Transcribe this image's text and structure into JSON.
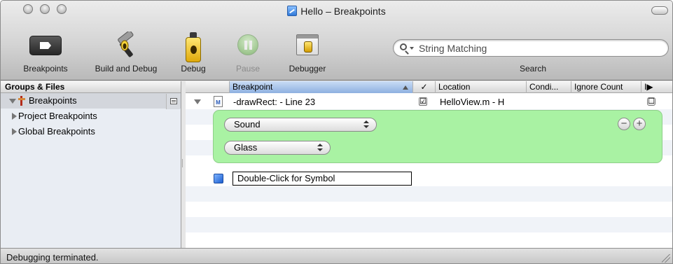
{
  "window": {
    "title": "Hello – Breakpoints"
  },
  "toolbar": {
    "breakpoints_label": "Breakpoints",
    "build_debug_label": "Build and Debug",
    "debug_label": "Debug",
    "pause_label": "Pause",
    "debugger_label": "Debugger",
    "search_placeholder": "String Matching",
    "search_label": "Search"
  },
  "sidebar": {
    "header": "Groups & Files",
    "items": [
      {
        "label": "Breakpoints"
      },
      {
        "label": "Project Breakpoints"
      },
      {
        "label": "Global Breakpoints"
      }
    ]
  },
  "table": {
    "columns": {
      "breakpoint": "Breakpoint",
      "enabled": "✓",
      "location": "Location",
      "condition": "Condi...",
      "ignore_count": "Ignore Count",
      "continue": "I▶"
    },
    "rows": [
      {
        "name": "-drawRect: - Line 23",
        "file_badge": "M",
        "enabled": "☑",
        "location": "HelloView.m - H",
        "continue": "☐"
      }
    ],
    "action": {
      "type_value": "Sound",
      "sound_value": "Glass",
      "remove": "−",
      "add": "+"
    },
    "new_symbol_placeholder": "Double-Click for Symbol"
  },
  "status": {
    "text": "Debugging terminated."
  }
}
